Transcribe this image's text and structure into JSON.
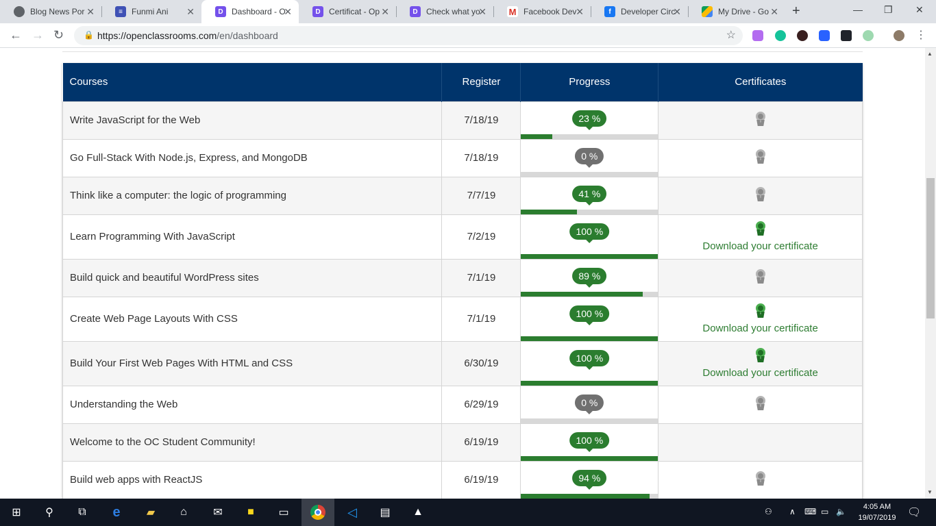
{
  "browser": {
    "tabs": [
      {
        "title": "Blog News Por",
        "favicon": "globe-icon",
        "active": false
      },
      {
        "title": "Funmi Ani",
        "favicon": "list-icon",
        "active": false
      },
      {
        "title": "Dashboard - O",
        "favicon": "openclassrooms-icon",
        "active": true
      },
      {
        "title": "Certificat - Op",
        "favicon": "openclassrooms-icon",
        "active": false
      },
      {
        "title": "Check what yo",
        "favicon": "openclassrooms-icon",
        "active": false
      },
      {
        "title": "Facebook Dev",
        "favicon": "gmail-icon",
        "active": false
      },
      {
        "title": "Developer Circ",
        "favicon": "facebook-icon",
        "active": false
      },
      {
        "title": "My Drive - Go",
        "favicon": "drive-icon",
        "active": false
      }
    ],
    "url_host": "https://openclassrooms.com",
    "url_path": "/en/dashboard"
  },
  "table": {
    "headers": {
      "courses": "Courses",
      "register": "Register",
      "progress": "Progress",
      "certificates": "Certificates"
    },
    "rows": [
      {
        "course": "Write JavaScript for the Web",
        "date": "7/18/19",
        "progress_label": "23 %",
        "progress": 0.23,
        "cert": "medal-grey",
        "download": ""
      },
      {
        "course": "Go Full-Stack With Node.js, Express, and MongoDB",
        "date": "7/18/19",
        "progress_label": "0 %",
        "progress": 0,
        "cert": "medal-grey",
        "download": ""
      },
      {
        "course": "Think like a computer: the logic of programming",
        "date": "7/7/19",
        "progress_label": "41 %",
        "progress": 0.41,
        "cert": "medal-grey",
        "download": ""
      },
      {
        "course": "Learn Programming With JavaScript",
        "date": "7/2/19",
        "progress_label": "100 %",
        "progress": 1,
        "cert": "medal-green",
        "download": "Download your certificate"
      },
      {
        "course": "Build quick and beautiful WordPress sites",
        "date": "7/1/19",
        "progress_label": "89 %",
        "progress": 0.89,
        "cert": "medal-grey",
        "download": ""
      },
      {
        "course": "Create Web Page Layouts With CSS",
        "date": "7/1/19",
        "progress_label": "100 %",
        "progress": 1,
        "cert": "medal-green",
        "download": "Download your certificate"
      },
      {
        "course": "Build Your First Web Pages With HTML and CSS",
        "date": "6/30/19",
        "progress_label": "100 %",
        "progress": 1,
        "cert": "medal-green",
        "download": "Download your certificate"
      },
      {
        "course": "Understanding the Web",
        "date": "6/29/19",
        "progress_label": "0 %",
        "progress": 0,
        "cert": "medal-grey",
        "download": ""
      },
      {
        "course": "Welcome to the OC Student Community!",
        "date": "6/19/19",
        "progress_label": "100 %",
        "progress": 1,
        "cert": "none",
        "download": ""
      },
      {
        "course": "Build web apps with ReactJS",
        "date": "6/19/19",
        "progress_label": "94 %",
        "progress": 0.94,
        "cert": "medal-grey",
        "download": ""
      }
    ]
  },
  "taskbar": {
    "time": "4:05 AM",
    "date": "19/07/2019"
  },
  "colors": {
    "header_bg": "#00346b",
    "progress_green": "#2b7d2f",
    "progress_zero": "#707070"
  }
}
